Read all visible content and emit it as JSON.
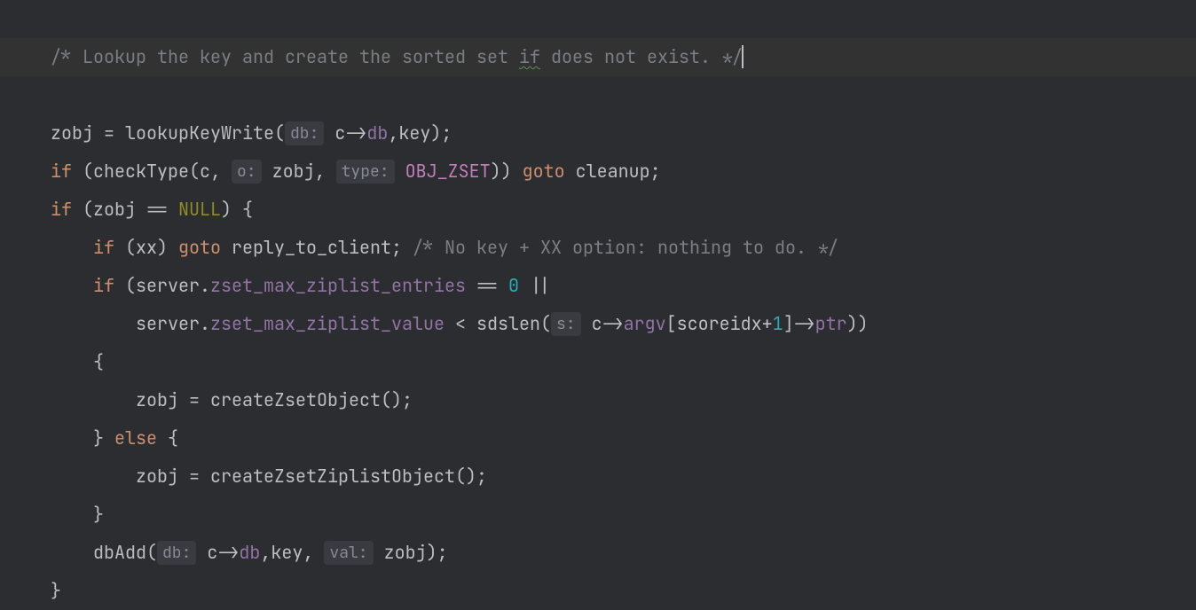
{
  "code": {
    "comment_top": "/* Lookup the key and create the sorted set ",
    "comment_if": "if",
    "comment_top_end": " does not exist. */",
    "zobj": "zobj",
    "assign": " = ",
    "lookupKeyWrite": "lookupKeyWrite",
    "lparen": "(",
    "rparen": ")",
    "hint_db": "db:",
    "sp": " ",
    "c": "c",
    "arrow": "->",
    "db": "db",
    "comma": ",",
    "key": "key",
    "semi": ";",
    "if_kw": "if",
    "checkType": "checkType",
    "hint_o": "o:",
    "hint_type": "type:",
    "OBJ_ZSET": "OBJ_ZSET",
    "goto_kw": "goto",
    "cleanup": "cleanup",
    "eqeq": " == ",
    "NULL": "NULL",
    "lbrace": "{",
    "rbrace": "}",
    "indent1": "    ",
    "indent2": "        ",
    "xx": "xx",
    "reply_to_client": "reply_to_client",
    "comment_xx": "/* No key + XX option: nothing to do. */",
    "server": "server",
    "dot": ".",
    "zset_max_ziplist_entries": "zset_max_ziplist_entries",
    "zero": "0",
    "pipes": " ||",
    "zset_max_ziplist_value": "zset_max_ziplist_value",
    "lt": " < ",
    "sdslen": "sdslen",
    "hint_s": "s:",
    "argv": "argv",
    "lbracket": "[",
    "rbracket": "]",
    "scoreidx": "scoreidx",
    "plus": "+",
    "one": "1",
    "ptr": "ptr",
    "createZsetObject": "createZsetObject",
    "else_kw": "else",
    "createZsetZiplistObject": "createZsetZiplistObject",
    "dbAdd": "dbAdd",
    "hint_val": "val:"
  }
}
